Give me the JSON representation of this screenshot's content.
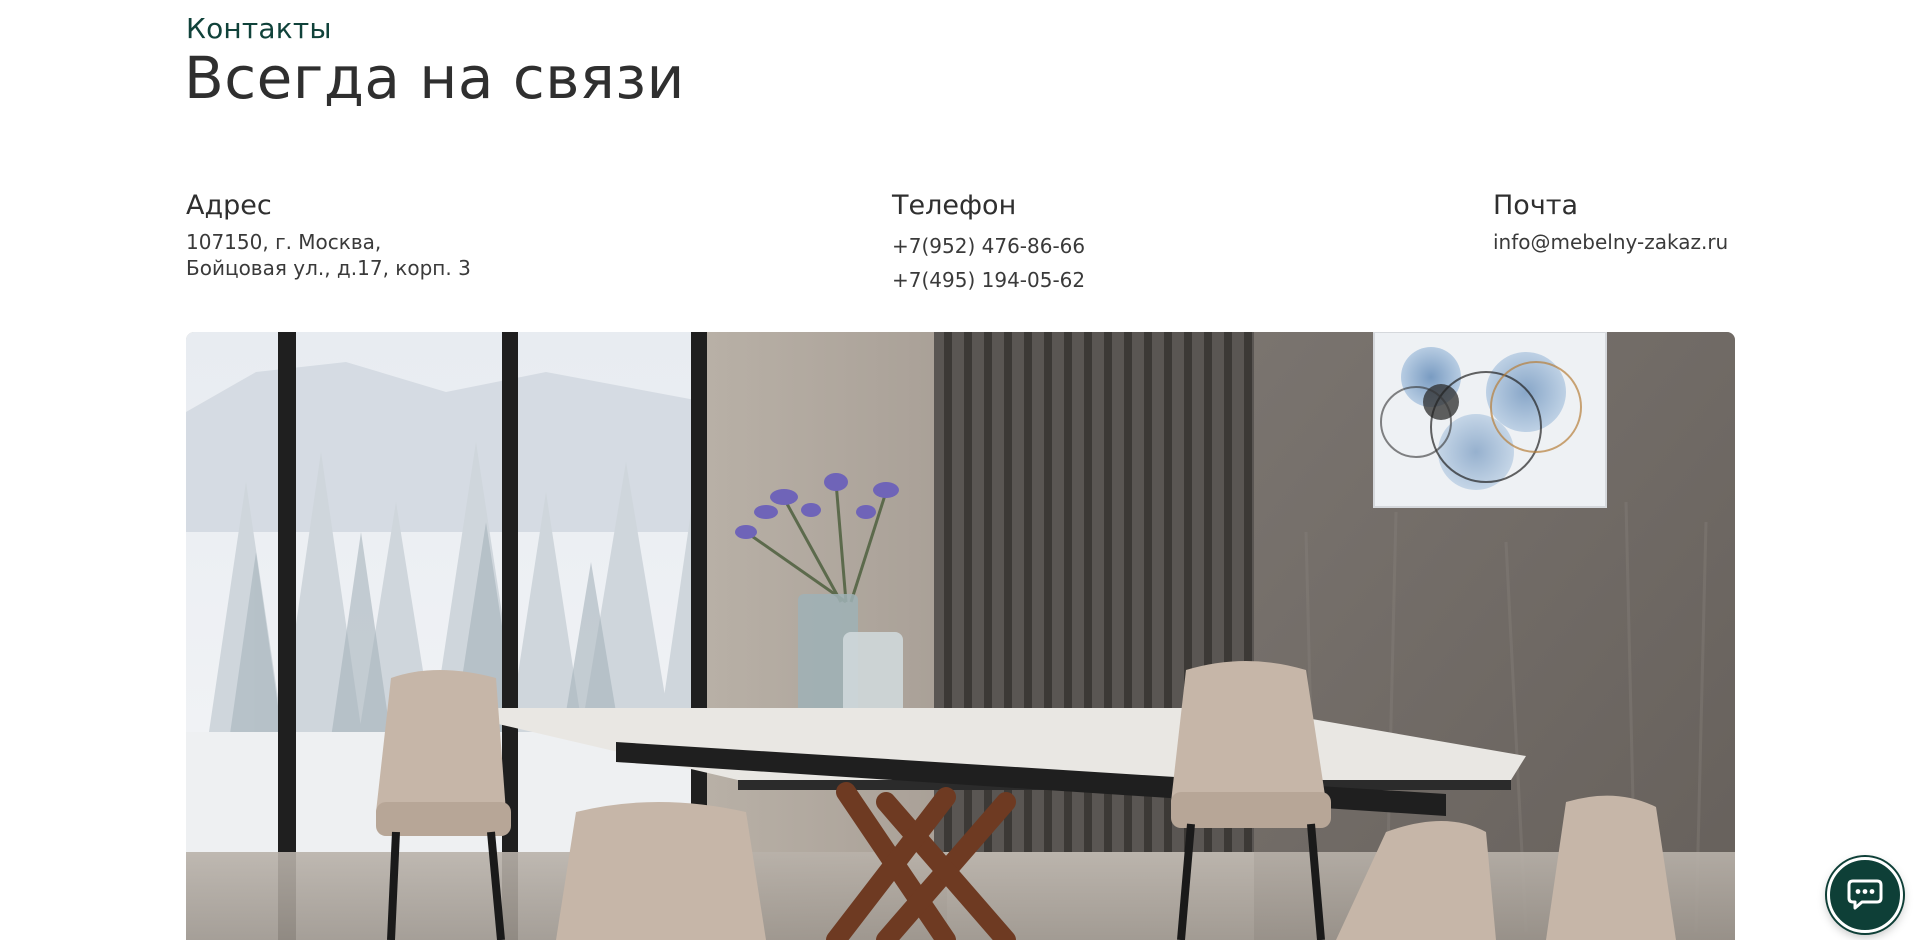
{
  "section": {
    "eyebrow": "Контакты",
    "title": "Всегда на связи"
  },
  "address": {
    "heading": "Адрес",
    "lines": [
      "107150, г. Москва,",
      "Бойцовая ул., д.17, корп. 3"
    ]
  },
  "phone": {
    "heading": "Телефон",
    "numbers": [
      "+7(952) 476-86-66",
      "+7(495) 194-05-62"
    ]
  },
  "mail": {
    "heading": "Почта",
    "email": "info@mebelny-zakaz.ru"
  },
  "colors": {
    "accent": "#0e3f37",
    "eyebrow": "#10423a",
    "text": "#2f2f2f"
  },
  "icons": {
    "chat": "chat-bubble-icon"
  }
}
